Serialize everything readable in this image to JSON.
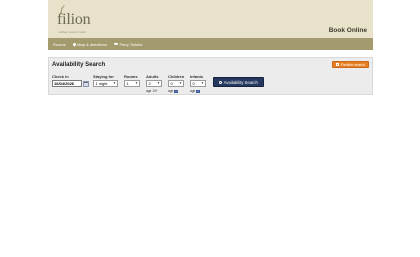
{
  "header": {
    "logo_text": "filion",
    "logo_subtitle": "coffee resort hotel",
    "logo_tagline": "",
    "book_online": "Book Online"
  },
  "nav": {
    "items": [
      {
        "label": "Rooms",
        "icon": "none"
      },
      {
        "label": "Map & directions",
        "icon": "map-pin-icon"
      },
      {
        "label": "Ferry Tickets",
        "icon": "ferry-icon"
      }
    ]
  },
  "search": {
    "title": "Availability Search",
    "rates_button": "Flexible search",
    "check_in_label": "Check in",
    "check_in_value": "16/04/2026",
    "staying_for_label": "Staying for",
    "staying_for_value": "1 night",
    "rooms_label": "Rooms",
    "rooms_value": "1",
    "adults_label": "Adults",
    "adults_value": "2",
    "adults_age": "age 13+",
    "children_label": "Children",
    "children_value": "0",
    "children_age": "age",
    "infants_label": "Infants",
    "infants_value": "0",
    "infants_age": "age",
    "search_button": "Availability Search"
  },
  "colors": {
    "header_bg": "#e7e2c9",
    "nav_bg": "#a39a6d",
    "search_button_bg": "#25385f",
    "rates_button_bg": "#e67e22"
  }
}
